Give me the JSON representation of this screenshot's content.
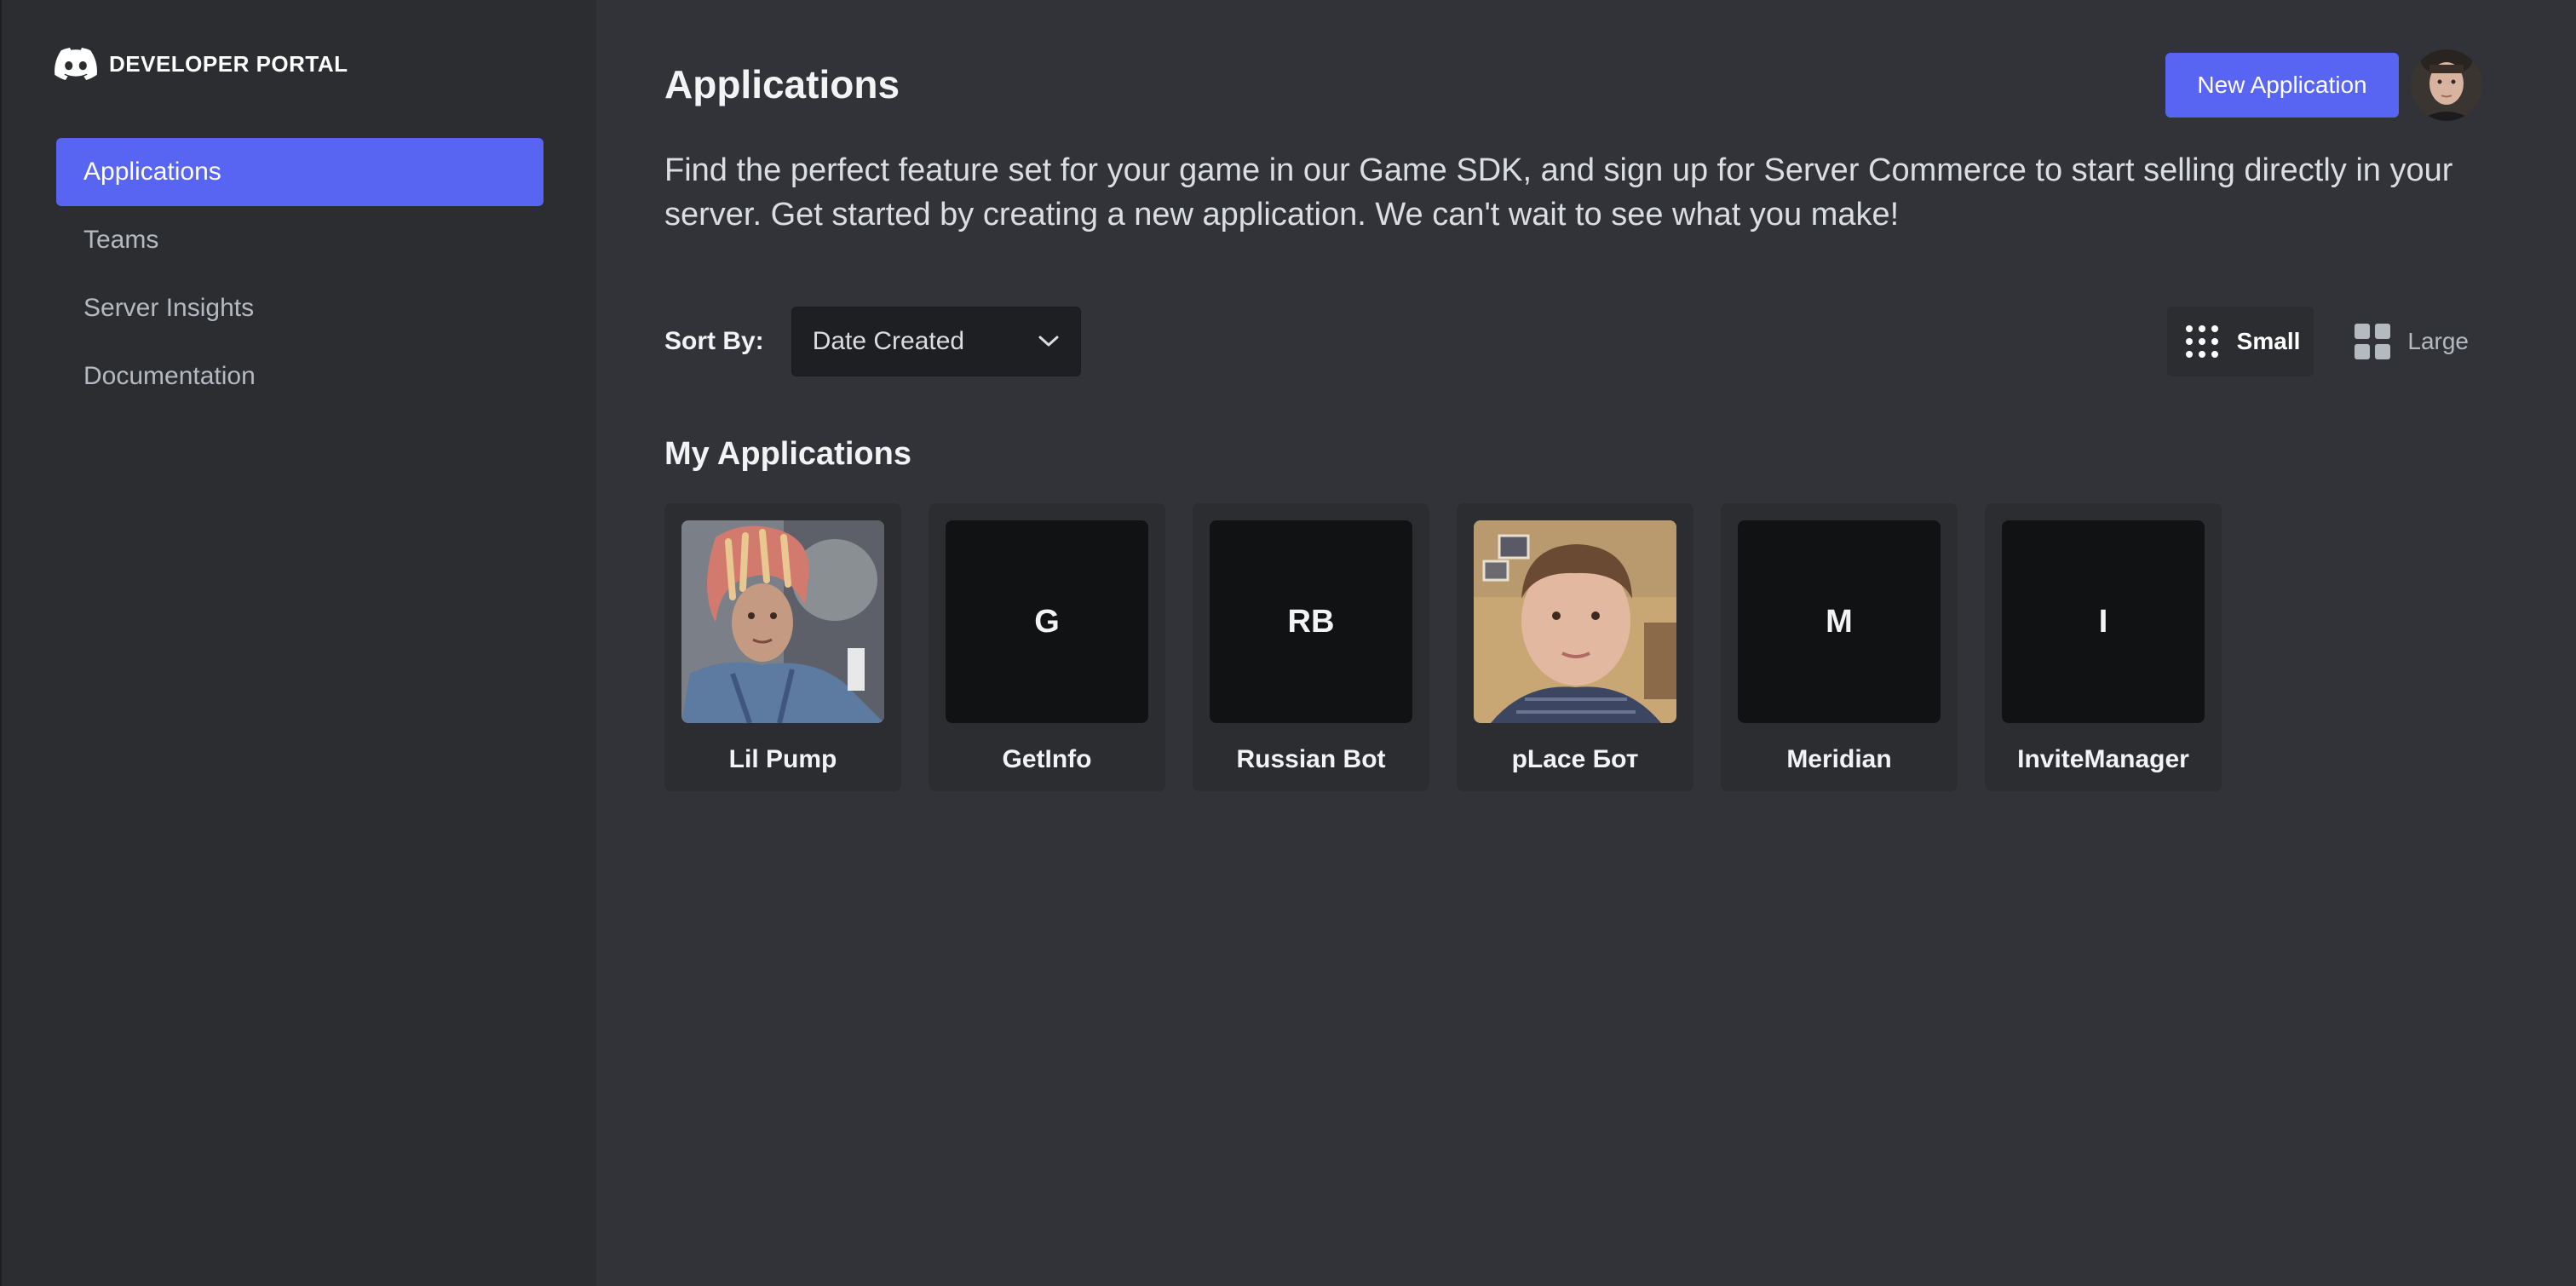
{
  "brand": {
    "title": "DEVELOPER PORTAL",
    "logo_icon": "discord-logo-icon"
  },
  "sidebar": {
    "items": [
      {
        "label": "Applications",
        "active": true
      },
      {
        "label": "Teams",
        "active": false
      },
      {
        "label": "Server Insights",
        "active": false
      },
      {
        "label": "Documentation",
        "active": false
      }
    ]
  },
  "header": {
    "title": "Applications",
    "new_app_label": "New Application",
    "avatar": "user-avatar"
  },
  "description": "Find the perfect feature set for your game in our Game SDK, and sign up for Server Commerce to start selling directly in your server. Get started by creating a new application. We can't wait to see what you make!",
  "toolbar": {
    "sort_label": "Sort By:",
    "sort_value": "Date Created",
    "view_small": "Small",
    "view_large": "Large",
    "selected_view": "Small"
  },
  "section_title": "My Applications",
  "applications": [
    {
      "name": "Lil Pump",
      "initials": "",
      "has_image": true
    },
    {
      "name": "GetInfo",
      "initials": "G",
      "has_image": false
    },
    {
      "name": "Russian Bot",
      "initials": "RB",
      "has_image": false
    },
    {
      "name": "pLace Бот",
      "initials": "",
      "has_image": true
    },
    {
      "name": "Meridian",
      "initials": "M",
      "has_image": false
    },
    {
      "name": "InviteManager",
      "initials": "I",
      "has_image": false
    }
  ],
  "colors": {
    "accent": "#5865f2",
    "background": "#313338",
    "sidebar": "#2b2d31",
    "icon_bg": "#111214"
  }
}
